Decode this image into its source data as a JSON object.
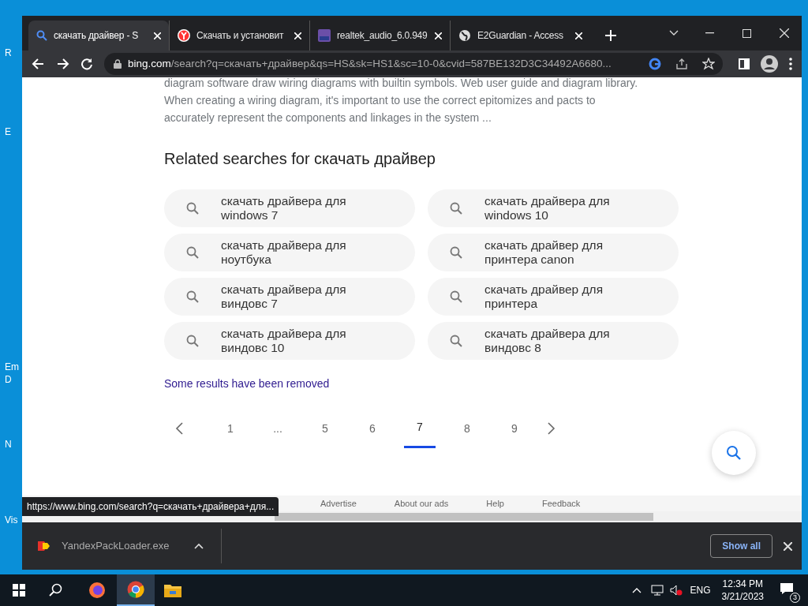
{
  "desktop_labels": [
    "R",
    "E",
    "Em",
    "D",
    "N",
    "Vis"
  ],
  "tabs": [
    {
      "title": "скачать драйвер - S",
      "kind": "search",
      "selected": true
    },
    {
      "title": "Скачать и установит",
      "kind": "yandex",
      "selected": false
    },
    {
      "title": "realtek_audio_6.0.949",
      "kind": "up",
      "selected": false
    },
    {
      "title": "E2Guardian - Access",
      "kind": "globe",
      "selected": false
    }
  ],
  "address": {
    "host": "bing.com",
    "path": "/search?q=скачать+драйвер&qs=HS&sk=HS1&sc=10-0&cvid=587BE132D3C34492A6680..."
  },
  "snippet": "diagram software draw wiring diagrams with builtin symbols. Web user guide and diagram library. When creating a wiring diagram, it's important to use the correct epitomizes and pacts to accurately represent the components and linkages in the system ...",
  "related": {
    "title": "Related searches for скачать драйвер",
    "items": [
      {
        "line1": "скачать драйвера для",
        "line2": "windows 7"
      },
      {
        "line1": "скачать драйвера для",
        "line2": "windows 10"
      },
      {
        "line1": "скачать драйвера для",
        "line2": "ноутбука"
      },
      {
        "line1": "скачать драйвер для",
        "line2": "принтера canon"
      },
      {
        "line1": "скачать драйвера для",
        "line2": "виндовс 7"
      },
      {
        "line1": "скачать драйвер для",
        "line2": "принтера"
      },
      {
        "line1": "скачать драйвера для",
        "line2": "виндовс 10"
      },
      {
        "line1": "скачать драйвера для",
        "line2": "виндовс 8"
      }
    ]
  },
  "removed_notice": "Some results have been removed",
  "pagination": [
    {
      "label": "1",
      "selected": false
    },
    {
      "label": "...",
      "selected": false
    },
    {
      "label": "5",
      "selected": false
    },
    {
      "label": "6",
      "selected": false
    },
    {
      "label": "7",
      "selected": true
    },
    {
      "label": "8",
      "selected": false
    },
    {
      "label": "9",
      "selected": false
    }
  ],
  "footer_links": [
    "Advertise",
    "About our ads",
    "Help",
    "Feedback"
  ],
  "status_url": "https://www.bing.com/search?q=скачать+драйвера+для...",
  "download": {
    "file": "YandexPackLoader.exe",
    "show_all": "Show all"
  },
  "tray": {
    "language": "ENG",
    "time": "12:34 PM",
    "date": "3/21/2023",
    "notifications": "3"
  }
}
